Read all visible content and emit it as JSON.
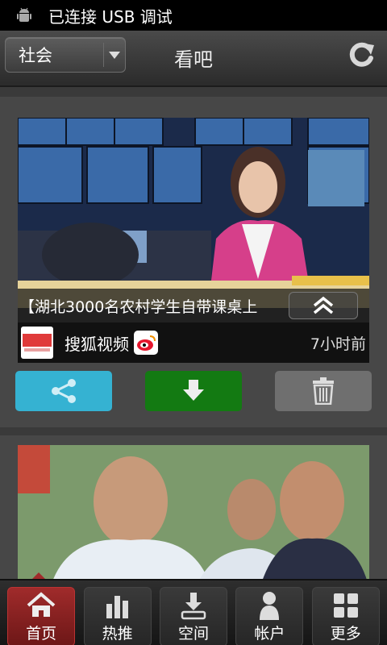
{
  "status_bar": {
    "text": "已连接 USB 调试",
    "icon": "android-debug-icon"
  },
  "top_bar": {
    "category": "社会",
    "title": "看吧",
    "refresh_icon": "refresh-icon"
  },
  "feed": [
    {
      "caption": "【湖北3000名农村学生自带课桌上",
      "source": "搜狐视频",
      "time": "7小时前",
      "logo_text": "搜狐视频"
    }
  ],
  "actions": {
    "share_icon": "share-icon",
    "download_icon": "download-icon",
    "delete_icon": "trash-icon"
  },
  "bottom_nav": [
    {
      "label": "首页",
      "icon": "home-icon",
      "active": true
    },
    {
      "label": "热推",
      "icon": "bar-chart-icon"
    },
    {
      "label": "空间",
      "icon": "download-tray-icon"
    },
    {
      "label": "帐户",
      "icon": "user-icon"
    },
    {
      "label": "更多",
      "icon": "grid-icon"
    }
  ],
  "colors": {
    "share": "#35b2d2",
    "download": "#137a12",
    "delete": "#6f6f6f",
    "active_tab": "#a02b2b"
  }
}
